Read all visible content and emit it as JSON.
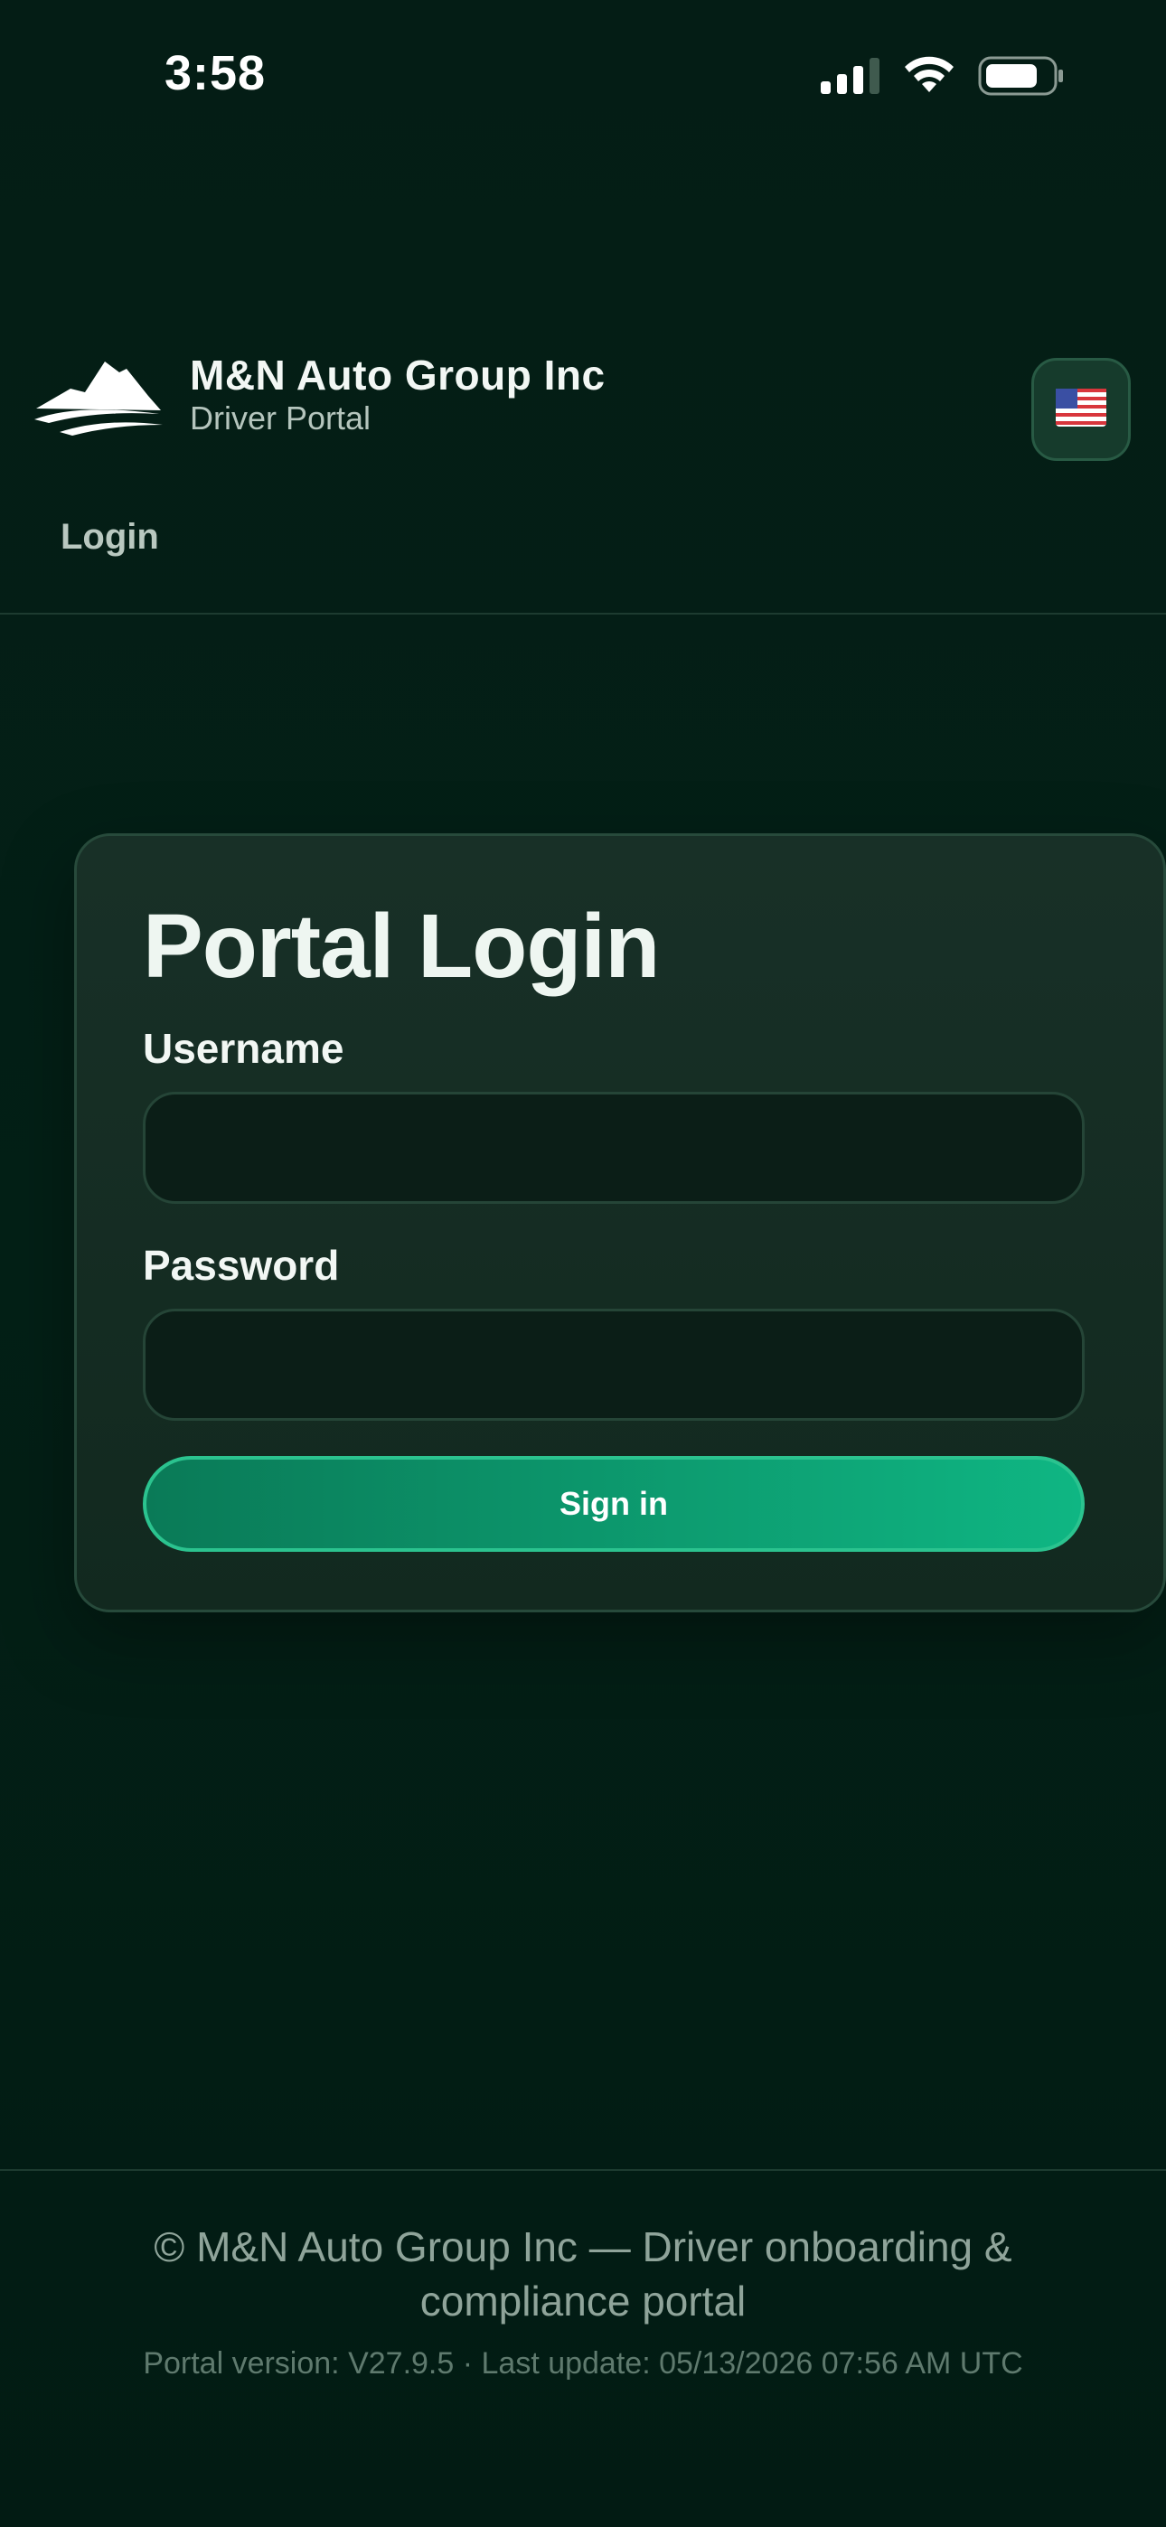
{
  "status_bar": {
    "time": "3:58"
  },
  "header": {
    "brand_name": "M&N Auto Group Inc",
    "brand_subtitle": "Driver Portal",
    "language_flag": "🇺🇸",
    "logo_icon": "mountain-logo-icon"
  },
  "nav": {
    "current": "Login"
  },
  "login_card": {
    "title": "Portal Login",
    "username_label": "Username",
    "username_value": "",
    "password_label": "Password",
    "password_value": "",
    "signin_label": "Sign in"
  },
  "footer": {
    "copyright": "© M&N Auto Group Inc — Driver onboarding & compliance portal",
    "version": "Portal version: V27.9.5 · Last update: 05/13/2026 07:56 AM UTC"
  },
  "colors": {
    "background": "#031d15",
    "accent": "#0fb683",
    "card": "#183027"
  }
}
